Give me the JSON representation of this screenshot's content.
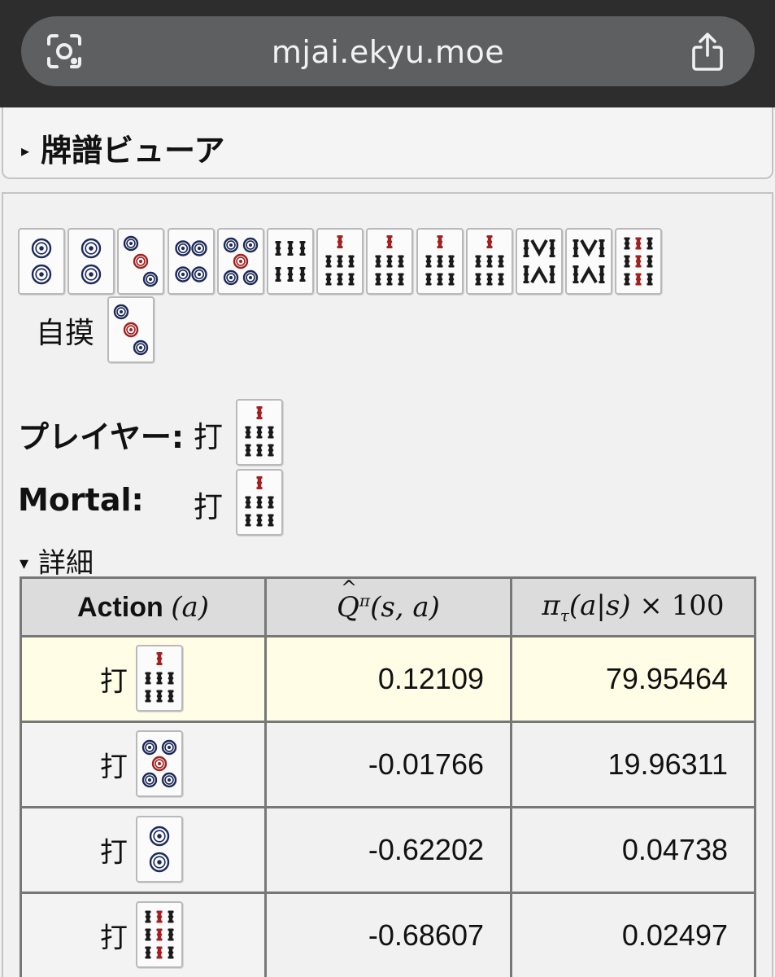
{
  "browser": {
    "url": "mjai.ekyu.moe",
    "left_icon": "lens-icon",
    "right_icon": "share-icon"
  },
  "viewer": {
    "title": "牌譜ビューア",
    "collapsed_marker": "▸"
  },
  "hand": {
    "tiles": [
      "2p",
      "2p",
      "3p",
      "4p",
      "5p",
      "6s",
      "7s",
      "7s",
      "7s",
      "7s",
      "8s",
      "8s",
      "9s"
    ],
    "draw_label": "自摸",
    "draw_tile": "3p"
  },
  "player": {
    "label": "プレイヤー:",
    "action": "打",
    "tile": "7s"
  },
  "mortal": {
    "label": "Mortal:",
    "action": "打",
    "tile": "7s"
  },
  "details": {
    "marker": "▾",
    "label": "詳細",
    "headers": {
      "action": "Action",
      "action_var": "(a)",
      "q": "Q̂^π(s, a)",
      "pi": "π_τ(a|s) × 100"
    },
    "rows": [
      {
        "action": "打",
        "tile": "7s",
        "q": "0.12109",
        "pi": "79.95464",
        "highlight": true
      },
      {
        "action": "打",
        "tile": "5p",
        "q": "-0.01766",
        "pi": "19.96311",
        "highlight": false
      },
      {
        "action": "打",
        "tile": "2p",
        "q": "-0.62202",
        "pi": "0.04738",
        "highlight": false
      },
      {
        "action": "打",
        "tile": "9s",
        "q": "-0.68607",
        "pi": "0.02497",
        "highlight": false
      }
    ]
  },
  "colors": {
    "browser_bg": "#2d2d2e",
    "url_pill": "#5d5f61",
    "highlight_row": "#fffde6",
    "header_bg": "#dcdcdc",
    "tile_black": "#1a1a1a",
    "tile_red": "#a32020",
    "tile_blue": "#1d2a5a"
  }
}
